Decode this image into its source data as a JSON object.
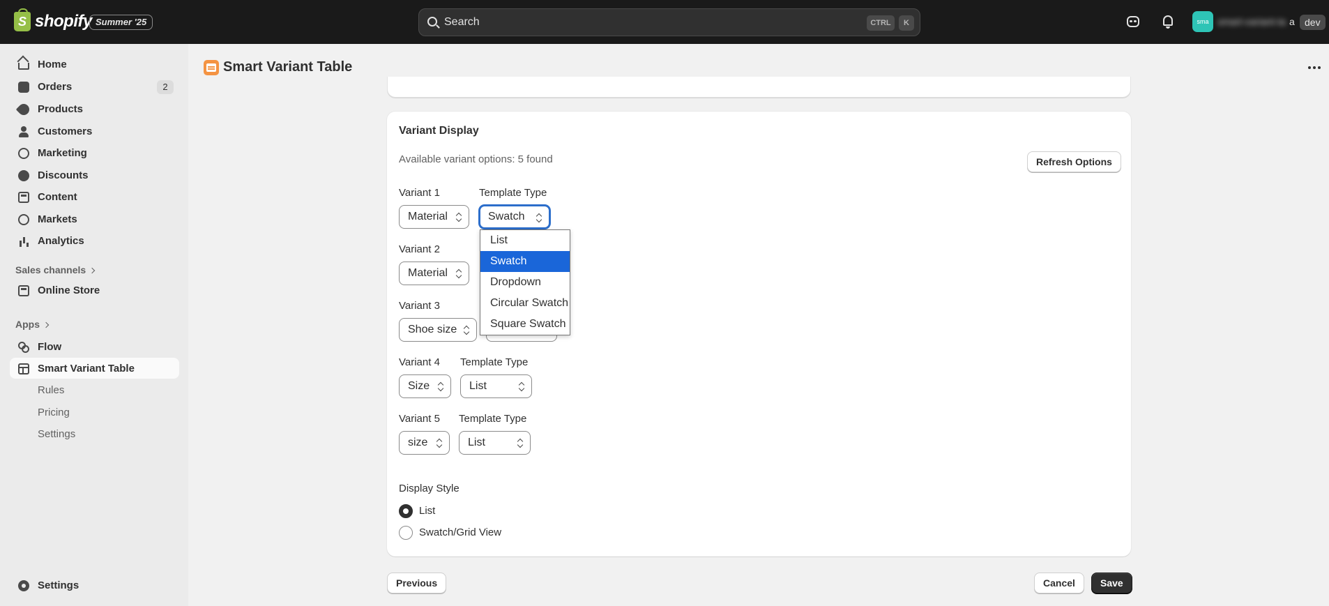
{
  "topbar": {
    "logo_text": "shopify",
    "logo_glyph": "S",
    "edition_badge": "Summer '25",
    "search_placeholder": "Search",
    "shortcut_ctrl": "CTRL",
    "shortcut_key": "K",
    "avatar_initials": "sma",
    "store_name": "smart-variant-ta",
    "store_suffix": "a",
    "env_badge": "dev"
  },
  "sidebar": {
    "items": [
      {
        "label": "Home",
        "icon": "home-icon"
      },
      {
        "label": "Orders",
        "icon": "orders-icon",
        "count": "2"
      },
      {
        "label": "Products",
        "icon": "tag-icon"
      },
      {
        "label": "Customers",
        "icon": "person-icon"
      },
      {
        "label": "Marketing",
        "icon": "target-icon"
      },
      {
        "label": "Discounts",
        "icon": "discount-icon"
      },
      {
        "label": "Content",
        "icon": "content-icon"
      },
      {
        "label": "Markets",
        "icon": "globe-icon"
      },
      {
        "label": "Analytics",
        "icon": "bar-chart-icon"
      }
    ],
    "sales_channels_label": "Sales channels",
    "online_store_label": "Online Store",
    "apps_label": "Apps",
    "flow_label": "Flow",
    "app_label": "Smart Variant Table",
    "app_sub_items": [
      "Rules",
      "Pricing",
      "Settings"
    ],
    "settings_label": "Settings"
  },
  "page": {
    "title": "Smart Variant Table"
  },
  "card": {
    "title": "Variant Display",
    "subtitle": "Available variant options: 5 found",
    "refresh_button": "Refresh Options",
    "variants": [
      {
        "label": "Variant 1",
        "value": "Material",
        "template_label": "Template Type",
        "template_value": "Swatch"
      },
      {
        "label": "Variant 2",
        "value": "Material"
      },
      {
        "label": "Variant 3",
        "value": "Shoe size"
      },
      {
        "label": "Variant 4",
        "value": "Size",
        "template_label": "Template Type",
        "template_value": "List"
      },
      {
        "label": "Variant 5",
        "value": "size",
        "template_label": "Template Type",
        "template_value": "List"
      }
    ],
    "dropdown_options": [
      "List",
      "Swatch",
      "Dropdown",
      "Circular Swatch",
      "Square Swatch"
    ],
    "dropdown_selected": "Swatch",
    "display_style_label": "Display Style",
    "display_style_options": [
      "List",
      "Swatch/Grid View"
    ],
    "display_style_selected": "List"
  },
  "footer": {
    "previous_button": "Previous",
    "cancel_button": "Cancel",
    "save_button": "Save"
  }
}
